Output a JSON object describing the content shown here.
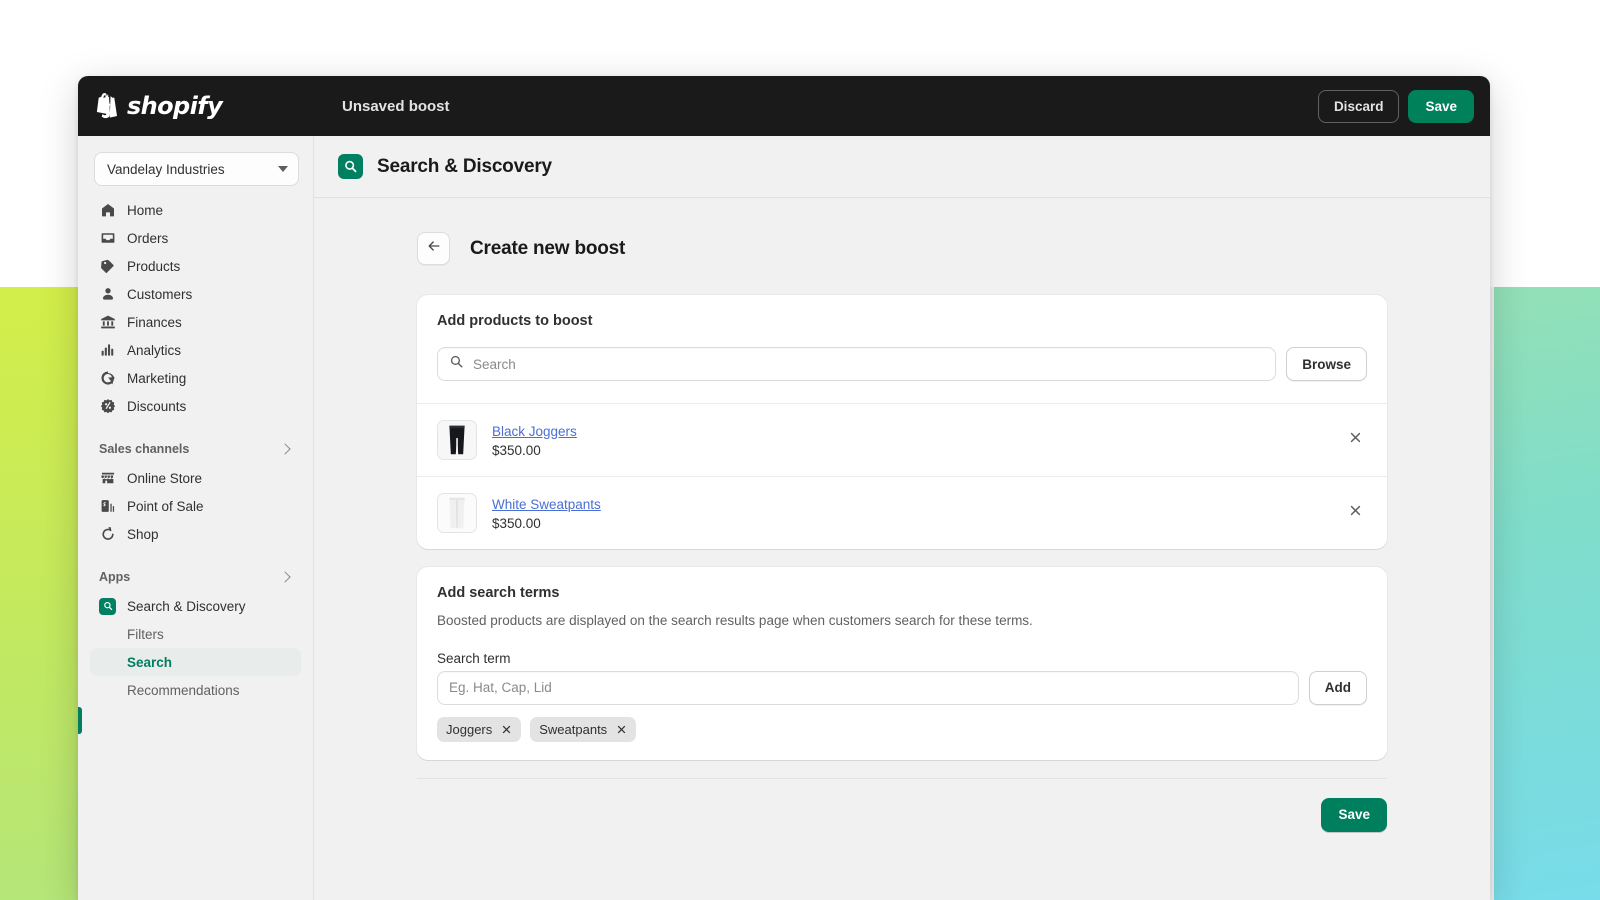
{
  "backdrop": {
    "left_color": "#c9ec4e",
    "right_color_top": "#93e0b6",
    "right_color_bottom": "#78dcea",
    "page_color": "#f4f4f4"
  },
  "topbar": {
    "logo_text": "shopify",
    "logo_icon": "shopify-bag-icon",
    "title": "Unsaved boost",
    "discard_label": "Discard",
    "save_label": "Save",
    "background": "#1a1a1a",
    "save_color": "#00815a"
  },
  "sidebar": {
    "store": {
      "name": "Vandelay Industries",
      "caret_icon": "chevron-down-icon"
    },
    "items": [
      {
        "label": "Home",
        "icon": "home-icon"
      },
      {
        "label": "Orders",
        "icon": "orders-inbox-icon"
      },
      {
        "label": "Products",
        "icon": "product-tag-icon"
      },
      {
        "label": "Customers",
        "icon": "person-icon"
      },
      {
        "label": "Finances",
        "icon": "bank-icon"
      },
      {
        "label": "Analytics",
        "icon": "bar-chart-icon"
      },
      {
        "label": "Marketing",
        "icon": "megaphone-target-icon"
      },
      {
        "label": "Discounts",
        "icon": "discount-percent-icon"
      }
    ],
    "sections": [
      {
        "label": "Sales channels",
        "chevron_icon": "chevron-right-icon",
        "items": [
          {
            "label": "Online Store",
            "icon": "storefront-icon"
          },
          {
            "label": "Point of Sale",
            "icon": "pos-device-icon"
          },
          {
            "label": "Shop",
            "icon": "shop-icon"
          }
        ]
      },
      {
        "label": "Apps",
        "chevron_icon": "chevron-right-icon",
        "items": [
          {
            "label": "Search & Discovery",
            "icon": "search-discovery-app-icon"
          }
        ]
      }
    ],
    "app_subitems": [
      {
        "label": "Filters",
        "active": false
      },
      {
        "label": "Search",
        "active": true
      },
      {
        "label": "Recommendations",
        "active": false
      }
    ],
    "active_accent_color": "#007f5f"
  },
  "app_header": {
    "icon": "search-discovery-app-icon",
    "title": "Search & Discovery",
    "icon_color": "#008060"
  },
  "page": {
    "back_icon": "arrow-left-icon",
    "title": "Create new boost"
  },
  "products_card": {
    "title": "Add products to boost",
    "search": {
      "icon": "search-icon",
      "placeholder": "Search",
      "value": ""
    },
    "browse_label": "Browse",
    "products": [
      {
        "name": "Black Joggers",
        "price": "$350.00",
        "thumb": "black-joggers-thumbnail",
        "remove_icon": "close-icon"
      },
      {
        "name": "White Sweatpants",
        "price": "$350.00",
        "thumb": "white-sweatpants-thumbnail",
        "remove_icon": "close-icon"
      }
    ]
  },
  "terms_card": {
    "title": "Add search terms",
    "description": "Boosted products are displayed on the search results page when customers search for these terms.",
    "field_label": "Search term",
    "input": {
      "placeholder": "Eg. Hat, Cap, Lid",
      "value": ""
    },
    "add_label": "Add",
    "tags": [
      {
        "label": "Joggers",
        "remove_icon": "close-icon"
      },
      {
        "label": "Sweatpants",
        "remove_icon": "close-icon"
      }
    ]
  },
  "footer": {
    "save_label": "Save",
    "save_color": "#007f5f"
  }
}
